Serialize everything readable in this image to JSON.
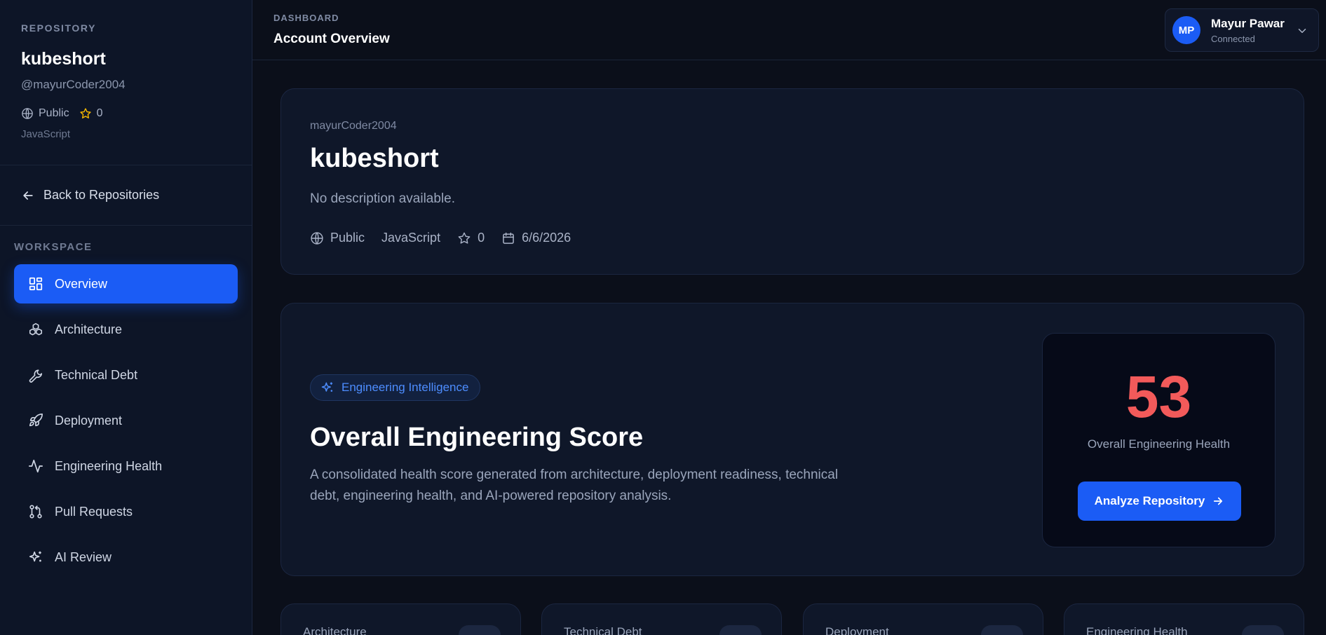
{
  "sidebar": {
    "kicker": "REPOSITORY",
    "repo_name": "kubeshort",
    "owner_handle": "@mayurCoder2004",
    "visibility": "Public",
    "stars": "0",
    "language": "JavaScript",
    "back_label": "Back to Repositories",
    "workspace_label": "WORKSPACE",
    "items": [
      {
        "label": "Overview",
        "icon": "grid-icon",
        "active": true
      },
      {
        "label": "Architecture",
        "icon": "cubes-icon"
      },
      {
        "label": "Technical Debt",
        "icon": "wrench-icon"
      },
      {
        "label": "Deployment",
        "icon": "rocket-icon"
      },
      {
        "label": "Engineering Health",
        "icon": "activity-icon"
      },
      {
        "label": "Pull Requests",
        "icon": "git-pull-request-icon"
      },
      {
        "label": "AI Review",
        "icon": "sparkles-icon"
      }
    ]
  },
  "header": {
    "breadcrumb": "DASHBOARD",
    "title": "Account Overview",
    "user": {
      "initials": "MP",
      "name": "Mayur Pawar",
      "status": "Connected"
    }
  },
  "repo_card": {
    "owner": "mayurCoder2004",
    "name": "kubeshort",
    "description": "No description available.",
    "visibility": "Public",
    "language": "JavaScript",
    "stars": "0",
    "date": "6/6/2026"
  },
  "score_card": {
    "chip_label": "Engineering Intelligence",
    "title": "Overall Engineering Score",
    "description": "A consolidated health score generated from architecture, deployment readiness, technical debt, engineering health, and AI-powered repository analysis.",
    "score": "53",
    "score_label": "Overall Engineering Health",
    "button_label": "Analyze Repository"
  },
  "mini_cards": [
    {
      "label": "Architecture"
    },
    {
      "label": "Technical Debt"
    },
    {
      "label": "Deployment"
    },
    {
      "label": "Engineering Health"
    }
  ],
  "colors": {
    "accent": "#1b5cf5",
    "score": "#f25a5a",
    "star": "#f5b800",
    "background": "#0b0f1a",
    "panel": "#0f1729"
  }
}
